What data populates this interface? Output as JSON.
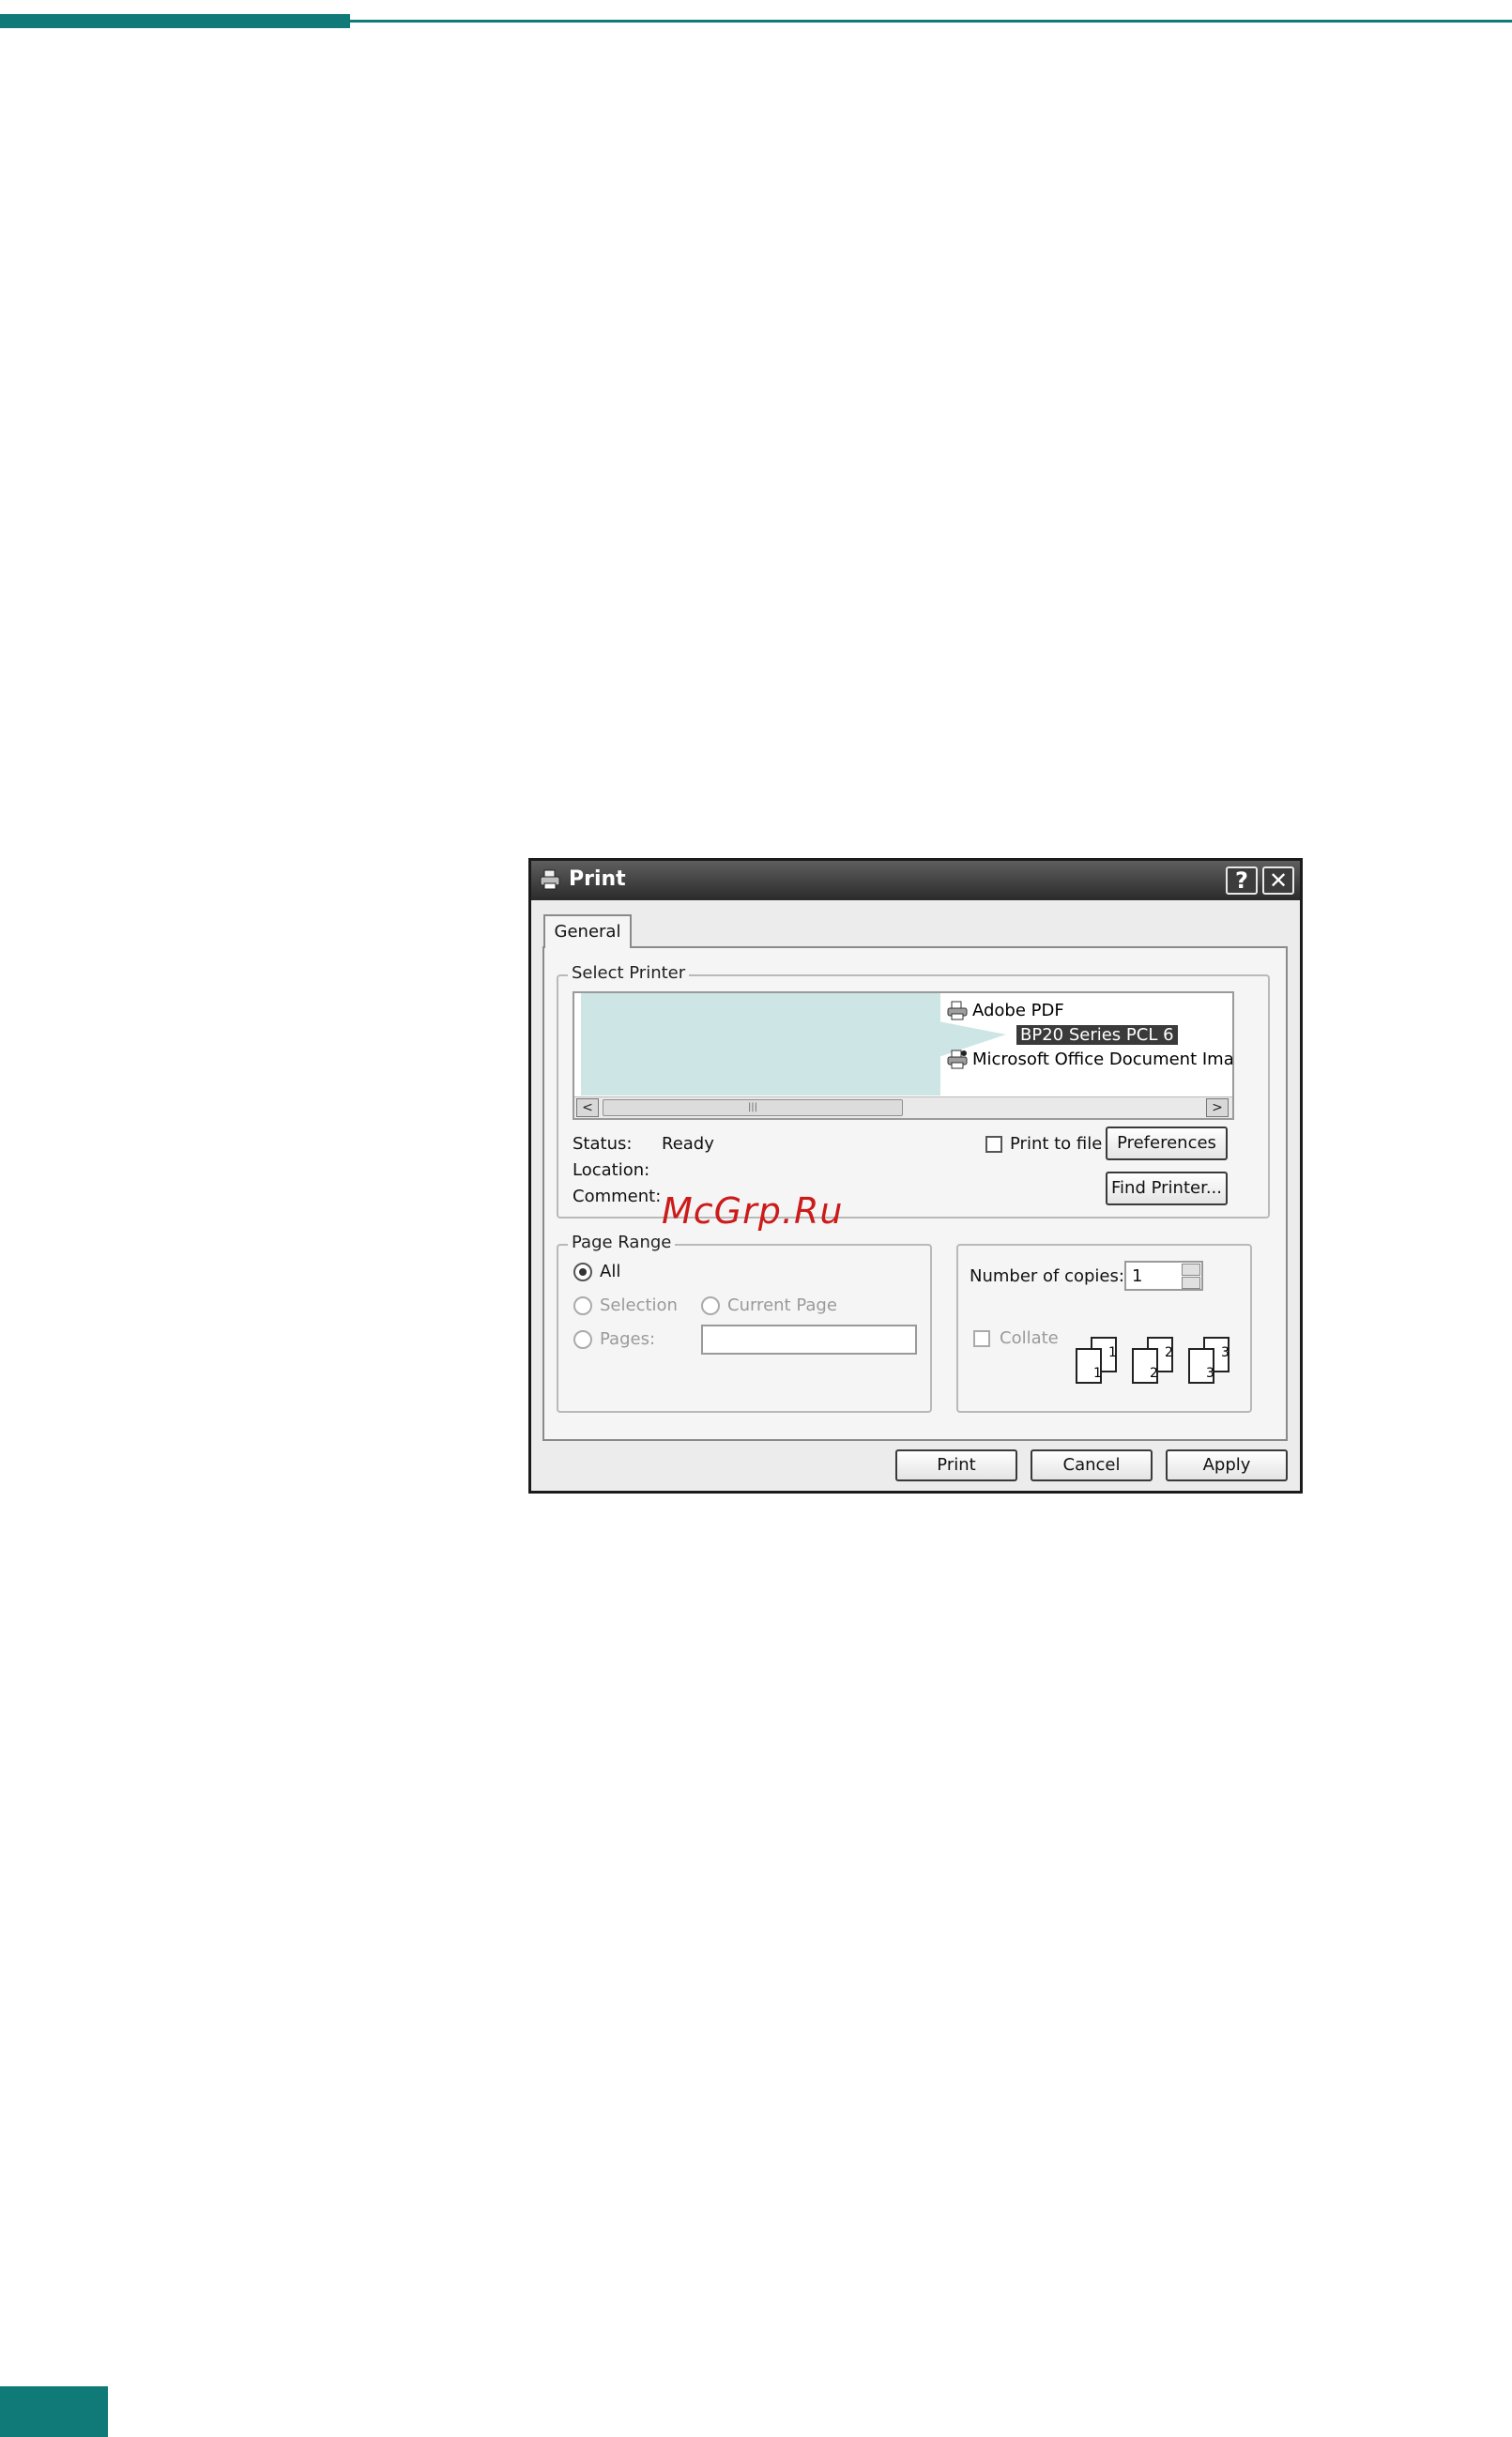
{
  "dialog": {
    "title": "Print",
    "help_button": "?",
    "close_button": "✕",
    "tab_general": "General",
    "select_printer": {
      "legend": "Select Printer",
      "printers": [
        "Adobe PDF",
        "BP20 Series PCL 6",
        "Microsoft Office Document Imag"
      ],
      "selected_index": 1,
      "scroll_left": "<",
      "scroll_right": ">",
      "scroll_grip": "|||"
    },
    "status_label": "Status:",
    "status_value": "Ready",
    "location_label": "Location:",
    "comment_label": "Comment:",
    "print_to_file_label": "Print to file",
    "print_to_file_checked": false,
    "preferences_button": "Preferences",
    "find_printer_button": "Find Printer...",
    "page_range": {
      "legend": "Page Range",
      "all": "All",
      "selection": "Selection",
      "current_page": "Current Page",
      "pages": "Pages:",
      "pages_value": "",
      "selected": "All"
    },
    "copies": {
      "label": "Number of copies:",
      "value": "1",
      "collate_label": "Collate",
      "collate_checked": false,
      "collate_numbers": [
        "1",
        "1",
        "2",
        "2",
        "3",
        "3"
      ]
    },
    "buttons": {
      "print": "Print",
      "cancel": "Cancel",
      "apply": "Apply"
    }
  },
  "watermark": "McGrp.Ru",
  "colors": {
    "accent_teal": "#0f7a78",
    "callout": "#cde6e5",
    "watermark": "#cc1b1b"
  }
}
